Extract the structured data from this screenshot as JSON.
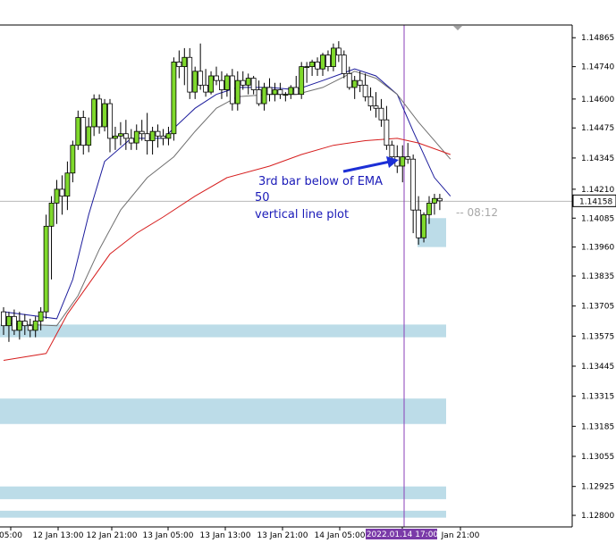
{
  "chart_data": {
    "type": "candlestick",
    "title": "",
    "ylim": [
      1.1275,
      1.1492
    ],
    "y_ticks": [
      1.14865,
      1.1474,
      1.146,
      1.14475,
      1.14345,
      1.1421,
      1.14085,
      1.1396,
      1.13835,
      1.13705,
      1.13575,
      1.13445,
      1.13315,
      1.13185,
      1.13055,
      1.12925,
      1.128
    ],
    "y_tick_labels": [
      "1.14865",
      "1.14740",
      "1.14600",
      "1.14475",
      "1.14345",
      "1.14210",
      "1.14085",
      "1.13960",
      "1.13835",
      "1.13705",
      "1.13575",
      "1.13445",
      "1.13315",
      "1.13185",
      "1.13055",
      "1.12925",
      "1.12800"
    ],
    "x_labels": [
      "05:00",
      "12 Jan 13:00",
      "12 Jan 21:00",
      "13 Jan 05:00",
      "13 Jan 13:00",
      "13 Jan 21:00",
      "14 Jan 05:00",
      "2022.01.14 17:00",
      "Jan 21:00"
    ],
    "bid_label": "1.14158",
    "bid_value": 1.14158,
    "timer_label": "-- 08:12",
    "annotation_lines": [
      "3rd bar below of EMA",
      "50",
      "vertical line plot"
    ],
    "vertical_line_label": "2022.01.14 17:00",
    "candles": [
      [
        1.1368,
        1.137,
        1.1358,
        1.1362
      ],
      [
        1.1362,
        1.1368,
        1.1355,
        1.1366
      ],
      [
        1.1366,
        1.1369,
        1.1358,
        1.136
      ],
      [
        1.136,
        1.1368,
        1.1356,
        1.1364
      ],
      [
        1.1364,
        1.1367,
        1.1358,
        1.1362
      ],
      [
        1.1362,
        1.1365,
        1.1357,
        1.136
      ],
      [
        1.136,
        1.1366,
        1.1357,
        1.1364
      ],
      [
        1.1364,
        1.137,
        1.136,
        1.1368
      ],
      [
        1.1368,
        1.141,
        1.1365,
        1.1405
      ],
      [
        1.1405,
        1.1418,
        1.1382,
        1.1415
      ],
      [
        1.1415,
        1.1425,
        1.1406,
        1.1421
      ],
      [
        1.1421,
        1.1427,
        1.141,
        1.1418
      ],
      [
        1.1418,
        1.1433,
        1.1412,
        1.1428
      ],
      [
        1.1428,
        1.1442,
        1.1424,
        1.144
      ],
      [
        1.144,
        1.1455,
        1.1438,
        1.1452
      ],
      [
        1.1452,
        1.1455,
        1.1436,
        1.144
      ],
      [
        1.144,
        1.1452,
        1.1437,
        1.1448
      ],
      [
        1.1448,
        1.1462,
        1.1444,
        1.146
      ],
      [
        1.146,
        1.1462,
        1.1445,
        1.1448
      ],
      [
        1.1448,
        1.146,
        1.1446,
        1.1458
      ],
      [
        1.1458,
        1.146,
        1.1437,
        1.1443
      ],
      [
        1.1443,
        1.1448,
        1.1438,
        1.1444
      ],
      [
        1.1444,
        1.145,
        1.144,
        1.1445
      ],
      [
        1.1445,
        1.1451,
        1.1438,
        1.1443
      ],
      [
        1.1443,
        1.1447,
        1.1438,
        1.1441
      ],
      [
        1.1441,
        1.1449,
        1.1438,
        1.1446
      ],
      [
        1.1446,
        1.1451,
        1.1442,
        1.1445
      ],
      [
        1.1445,
        1.1454,
        1.1436,
        1.1442
      ],
      [
        1.1442,
        1.1448,
        1.1436,
        1.1446
      ],
      [
        1.1446,
        1.1449,
        1.1439,
        1.1444
      ],
      [
        1.1444,
        1.1447,
        1.144,
        1.1443
      ],
      [
        1.1443,
        1.1448,
        1.144,
        1.1445
      ],
      [
        1.1445,
        1.1478,
        1.1442,
        1.1476
      ],
      [
        1.1476,
        1.1481,
        1.1469,
        1.1474
      ],
      [
        1.1474,
        1.1482,
        1.1466,
        1.1478
      ],
      [
        1.1478,
        1.1482,
        1.146,
        1.1463
      ],
      [
        1.1463,
        1.1474,
        1.146,
        1.1472
      ],
      [
        1.1472,
        1.1484,
        1.1464,
        1.1466
      ],
      [
        1.1466,
        1.1473,
        1.1461,
        1.1463
      ],
      [
        1.1463,
        1.1472,
        1.1462,
        1.147
      ],
      [
        1.147,
        1.1474,
        1.1466,
        1.1468
      ],
      [
        1.1468,
        1.1472,
        1.146,
        1.1464
      ],
      [
        1.1464,
        1.1471,
        1.1461,
        1.147
      ],
      [
        1.147,
        1.1473,
        1.1455,
        1.1458
      ],
      [
        1.1458,
        1.1472,
        1.1455,
        1.1468
      ],
      [
        1.1468,
        1.1472,
        1.1464,
        1.1466
      ],
      [
        1.1466,
        1.1471,
        1.1462,
        1.1469
      ],
      [
        1.1469,
        1.147,
        1.1462,
        1.1464
      ],
      [
        1.1464,
        1.1468,
        1.1457,
        1.1458
      ],
      [
        1.1458,
        1.1467,
        1.1455,
        1.1465
      ],
      [
        1.1465,
        1.1469,
        1.1459,
        1.1462
      ],
      [
        1.1462,
        1.1467,
        1.1459,
        1.1464
      ],
      [
        1.1464,
        1.1467,
        1.146,
        1.1462
      ],
      [
        1.1462,
        1.1463,
        1.1459,
        1.1462
      ],
      [
        1.1462,
        1.1466,
        1.146,
        1.1465
      ],
      [
        1.1465,
        1.147,
        1.1462,
        1.1462
      ],
      [
        1.1462,
        1.1476,
        1.146,
        1.1474
      ],
      [
        1.1474,
        1.1476,
        1.1467,
        1.1474
      ],
      [
        1.1474,
        1.1477,
        1.147,
        1.1476
      ],
      [
        1.1476,
        1.1478,
        1.147,
        1.1473
      ],
      [
        1.1473,
        1.148,
        1.147,
        1.1479
      ],
      [
        1.1479,
        1.1481,
        1.1472,
        1.1474
      ],
      [
        1.1474,
        1.1484,
        1.1472,
        1.1482
      ],
      [
        1.1482,
        1.1485,
        1.1476,
        1.1479
      ],
      [
        1.1479,
        1.1481,
        1.1469,
        1.1471
      ],
      [
        1.1471,
        1.1474,
        1.1464,
        1.1465
      ],
      [
        1.1465,
        1.147,
        1.146,
        1.1468
      ],
      [
        1.1468,
        1.1472,
        1.1463,
        1.1466
      ],
      [
        1.1466,
        1.1471,
        1.1459,
        1.1461
      ],
      [
        1.1461,
        1.1465,
        1.1455,
        1.1457
      ],
      [
        1.1457,
        1.1463,
        1.1452,
        1.1456
      ],
      [
        1.1456,
        1.146,
        1.1448,
        1.1451
      ],
      [
        1.1451,
        1.1457,
        1.1438,
        1.144
      ],
      [
        1.144,
        1.1442,
        1.1432,
        1.1435
      ],
      [
        1.1435,
        1.144,
        1.1428,
        1.1431
      ],
      [
        1.1431,
        1.144,
        1.1424,
        1.1435
      ],
      [
        1.1435,
        1.1441,
        1.1432,
        1.1434
      ],
      [
        1.1434,
        1.1436,
        1.1402,
        1.1412
      ],
      [
        1.1412,
        1.1418,
        1.1397,
        1.14
      ],
      [
        1.14,
        1.1411,
        1.1398,
        1.141
      ],
      [
        1.141,
        1.1418,
        1.1406,
        1.1415
      ],
      [
        1.1415,
        1.1419,
        1.141,
        1.1417
      ],
      [
        1.1417,
        1.1419,
        1.1412,
        1.1416
      ]
    ],
    "ema_fast": [
      [
        0,
        1.1368
      ],
      [
        10,
        1.1365
      ],
      [
        13,
        1.1382
      ],
      [
        16,
        1.141
      ],
      [
        19,
        1.1433
      ],
      [
        24,
        1.1443
      ],
      [
        30,
        1.1443
      ],
      [
        36,
        1.1456
      ],
      [
        40,
        1.1462
      ],
      [
        44,
        1.1465
      ],
      [
        50,
        1.1465
      ],
      [
        55,
        1.1464
      ],
      [
        60,
        1.1468
      ],
      [
        66,
        1.1473
      ],
      [
        70,
        1.147
      ],
      [
        74,
        1.1462
      ],
      [
        77,
        1.1446
      ],
      [
        81,
        1.1426
      ],
      [
        84,
        1.1418
      ]
    ],
    "ema_mid": [
      [
        0,
        1.1363
      ],
      [
        10,
        1.1362
      ],
      [
        14,
        1.1375
      ],
      [
        18,
        1.1395
      ],
      [
        22,
        1.1412
      ],
      [
        27,
        1.1426
      ],
      [
        32,
        1.1435
      ],
      [
        36,
        1.1446
      ],
      [
        40,
        1.1456
      ],
      [
        44,
        1.1461
      ],
      [
        50,
        1.1462
      ],
      [
        55,
        1.1462
      ],
      [
        60,
        1.1465
      ],
      [
        66,
        1.1472
      ],
      [
        70,
        1.1469
      ],
      [
        74,
        1.1462
      ],
      [
        78,
        1.145
      ],
      [
        84,
        1.1434
      ]
    ],
    "ema_slow": [
      [
        0,
        1.1347
      ],
      [
        8,
        1.135
      ],
      [
        12,
        1.1367
      ],
      [
        16,
        1.138
      ],
      [
        20,
        1.1393
      ],
      [
        25,
        1.1402
      ],
      [
        30,
        1.1409
      ],
      [
        36,
        1.1418
      ],
      [
        42,
        1.1426
      ],
      [
        50,
        1.1431
      ],
      [
        56,
        1.1436
      ],
      [
        62,
        1.144
      ],
      [
        68,
        1.1442
      ],
      [
        74,
        1.1443
      ],
      [
        78,
        1.1441
      ],
      [
        84,
        1.1436
      ]
    ],
    "zones": [
      [
        1.13625,
        1.1357
      ],
      [
        1.13305,
        1.13195
      ],
      [
        1.12925,
        1.1287
      ],
      [
        1.1282,
        1.1279
      ]
    ],
    "upper_box": [
      1.14085,
      1.1396
    ],
    "colors": {
      "up_body": "#7fd92c",
      "down_body": "#ffffff",
      "wick": "#000000",
      "ema_fast": "#1c1c9c",
      "ema_mid": "#707070",
      "ema_slow": "#d61e1e",
      "zone": "#bcdce8",
      "vertical_line": "#8a3fb8",
      "arrow": "#1c2fd6",
      "bid_line": "#b8b8b8",
      "date_badge": "#7a3aa8"
    }
  }
}
